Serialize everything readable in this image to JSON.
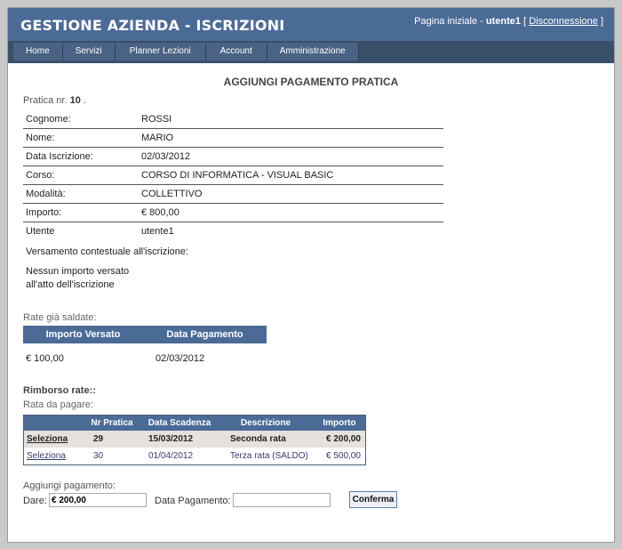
{
  "header": {
    "title": "Gestione Azienda - Iscrizioni",
    "home_link": "Pagina iniziale",
    "username": "utente1",
    "logout_label": "Disconnessione"
  },
  "menu": [
    {
      "label": "Home"
    },
    {
      "label": "Servizi"
    },
    {
      "label": "Planner Lezioni"
    },
    {
      "label": "Account"
    },
    {
      "label": "Amministrazione"
    }
  ],
  "main": {
    "title": "AGGIUNGI PAGAMENTO PRATICA",
    "practice_prefix": "Pratica nr.",
    "practice_no": "10",
    "practice_suffix": ".",
    "details": [
      {
        "label": "Cognome:",
        "value": "ROSSI"
      },
      {
        "label": "Nome:",
        "value": "MARIO"
      },
      {
        "label": "Data Iscrizione:",
        "value": "02/03/2012"
      },
      {
        "label": "Corso:",
        "value": "CORSO DI INFORMATICA - VISUAL BASIC"
      },
      {
        "label": "Modalità:",
        "value": "COLLETTIVO"
      },
      {
        "label": "Importo:",
        "value": "€ 800,00"
      },
      {
        "label": "Utente",
        "value": "utente1"
      }
    ],
    "versamento_label": "Versamento contestuale all'iscrizione:",
    "versamento_value": "Nessun importo versato all'atto dell'iscrizione"
  },
  "paid": {
    "label": "Rate già saldate:",
    "headers": [
      "Importo Versato",
      "Data Pagamento"
    ],
    "rows": [
      [
        "€ 100,00",
        "02/03/2012"
      ]
    ]
  },
  "due": {
    "rimborso_label": "Rimborso rate::",
    "label": "Rata da pagare:",
    "headers": [
      "",
      "Nr Pratica",
      "Data Scadenza",
      "Descrizione",
      "Importo"
    ],
    "rows": [
      {
        "select": "Seleziona",
        "nr": "29",
        "date": "15/03/2012",
        "desc": "Seconda rata",
        "amount": "€ 200,00"
      },
      {
        "select": "Seleziona",
        "nr": "30",
        "date": "01/04/2012",
        "desc": "Terza rata (SALDO)",
        "amount": "€ 500,00"
      }
    ]
  },
  "form": {
    "section_label": "Aggiungi pagamento:",
    "dare_label": "Dare:",
    "dare_value": "€ 200,00",
    "date_label": "Data Pagamento:",
    "date_value": "",
    "confirm_label": "Conferma"
  },
  "colors": {
    "header_bg": "#4b6b97",
    "menu_bg": "#3a4f6a",
    "selected_row": "#e5e1dc"
  }
}
